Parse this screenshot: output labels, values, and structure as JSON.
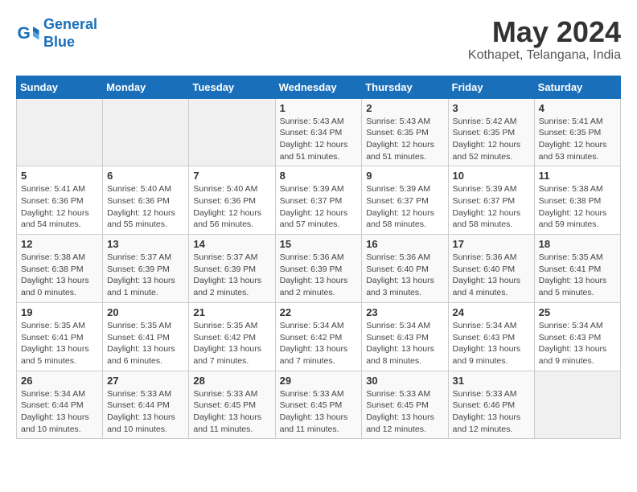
{
  "header": {
    "logo_line1": "General",
    "logo_line2": "Blue",
    "month_year": "May 2024",
    "location": "Kothapet, Telangana, India"
  },
  "days_of_week": [
    "Sunday",
    "Monday",
    "Tuesday",
    "Wednesday",
    "Thursday",
    "Friday",
    "Saturday"
  ],
  "weeks": [
    [
      {
        "day": "",
        "info": ""
      },
      {
        "day": "",
        "info": ""
      },
      {
        "day": "",
        "info": ""
      },
      {
        "day": "1",
        "info": "Sunrise: 5:43 AM\nSunset: 6:34 PM\nDaylight: 12 hours and 51 minutes."
      },
      {
        "day": "2",
        "info": "Sunrise: 5:43 AM\nSunset: 6:35 PM\nDaylight: 12 hours and 51 minutes."
      },
      {
        "day": "3",
        "info": "Sunrise: 5:42 AM\nSunset: 6:35 PM\nDaylight: 12 hours and 52 minutes."
      },
      {
        "day": "4",
        "info": "Sunrise: 5:41 AM\nSunset: 6:35 PM\nDaylight: 12 hours and 53 minutes."
      }
    ],
    [
      {
        "day": "5",
        "info": "Sunrise: 5:41 AM\nSunset: 6:36 PM\nDaylight: 12 hours and 54 minutes."
      },
      {
        "day": "6",
        "info": "Sunrise: 5:40 AM\nSunset: 6:36 PM\nDaylight: 12 hours and 55 minutes."
      },
      {
        "day": "7",
        "info": "Sunrise: 5:40 AM\nSunset: 6:36 PM\nDaylight: 12 hours and 56 minutes."
      },
      {
        "day": "8",
        "info": "Sunrise: 5:39 AM\nSunset: 6:37 PM\nDaylight: 12 hours and 57 minutes."
      },
      {
        "day": "9",
        "info": "Sunrise: 5:39 AM\nSunset: 6:37 PM\nDaylight: 12 hours and 58 minutes."
      },
      {
        "day": "10",
        "info": "Sunrise: 5:39 AM\nSunset: 6:37 PM\nDaylight: 12 hours and 58 minutes."
      },
      {
        "day": "11",
        "info": "Sunrise: 5:38 AM\nSunset: 6:38 PM\nDaylight: 12 hours and 59 minutes."
      }
    ],
    [
      {
        "day": "12",
        "info": "Sunrise: 5:38 AM\nSunset: 6:38 PM\nDaylight: 13 hours and 0 minutes."
      },
      {
        "day": "13",
        "info": "Sunrise: 5:37 AM\nSunset: 6:39 PM\nDaylight: 13 hours and 1 minute."
      },
      {
        "day": "14",
        "info": "Sunrise: 5:37 AM\nSunset: 6:39 PM\nDaylight: 13 hours and 2 minutes."
      },
      {
        "day": "15",
        "info": "Sunrise: 5:36 AM\nSunset: 6:39 PM\nDaylight: 13 hours and 2 minutes."
      },
      {
        "day": "16",
        "info": "Sunrise: 5:36 AM\nSunset: 6:40 PM\nDaylight: 13 hours and 3 minutes."
      },
      {
        "day": "17",
        "info": "Sunrise: 5:36 AM\nSunset: 6:40 PM\nDaylight: 13 hours and 4 minutes."
      },
      {
        "day": "18",
        "info": "Sunrise: 5:35 AM\nSunset: 6:41 PM\nDaylight: 13 hours and 5 minutes."
      }
    ],
    [
      {
        "day": "19",
        "info": "Sunrise: 5:35 AM\nSunset: 6:41 PM\nDaylight: 13 hours and 5 minutes."
      },
      {
        "day": "20",
        "info": "Sunrise: 5:35 AM\nSunset: 6:41 PM\nDaylight: 13 hours and 6 minutes."
      },
      {
        "day": "21",
        "info": "Sunrise: 5:35 AM\nSunset: 6:42 PM\nDaylight: 13 hours and 7 minutes."
      },
      {
        "day": "22",
        "info": "Sunrise: 5:34 AM\nSunset: 6:42 PM\nDaylight: 13 hours and 7 minutes."
      },
      {
        "day": "23",
        "info": "Sunrise: 5:34 AM\nSunset: 6:43 PM\nDaylight: 13 hours and 8 minutes."
      },
      {
        "day": "24",
        "info": "Sunrise: 5:34 AM\nSunset: 6:43 PM\nDaylight: 13 hours and 9 minutes."
      },
      {
        "day": "25",
        "info": "Sunrise: 5:34 AM\nSunset: 6:43 PM\nDaylight: 13 hours and 9 minutes."
      }
    ],
    [
      {
        "day": "26",
        "info": "Sunrise: 5:34 AM\nSunset: 6:44 PM\nDaylight: 13 hours and 10 minutes."
      },
      {
        "day": "27",
        "info": "Sunrise: 5:33 AM\nSunset: 6:44 PM\nDaylight: 13 hours and 10 minutes."
      },
      {
        "day": "28",
        "info": "Sunrise: 5:33 AM\nSunset: 6:45 PM\nDaylight: 13 hours and 11 minutes."
      },
      {
        "day": "29",
        "info": "Sunrise: 5:33 AM\nSunset: 6:45 PM\nDaylight: 13 hours and 11 minutes."
      },
      {
        "day": "30",
        "info": "Sunrise: 5:33 AM\nSunset: 6:45 PM\nDaylight: 13 hours and 12 minutes."
      },
      {
        "day": "31",
        "info": "Sunrise: 5:33 AM\nSunset: 6:46 PM\nDaylight: 13 hours and 12 minutes."
      },
      {
        "day": "",
        "info": ""
      }
    ]
  ]
}
